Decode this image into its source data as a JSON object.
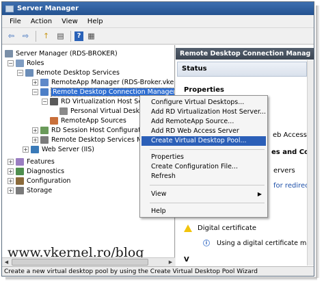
{
  "window": {
    "title": "Server Manager"
  },
  "menu": [
    "File",
    "Action",
    "View",
    "Help"
  ],
  "toolbar": {
    "icons": [
      "back-arrow-icon",
      "forward-arrow-icon",
      "up-folder-icon",
      "show-hide-tree-icon",
      "help-icon",
      "properties-icon"
    ],
    "glyphs": [
      "⇦",
      "⇨",
      "↑",
      "▤",
      "?",
      "▦"
    ]
  },
  "tree": {
    "items": [
      {
        "label": "Server Manager (RDS-BROKER)",
        "expander": ""
      },
      {
        "label": "Roles",
        "expander": "−"
      },
      {
        "label": "Remote Desktop Services",
        "expander": "−"
      },
      {
        "label": "RemoteApp Manager (RDS-Broker.vkern",
        "expander": "+"
      },
      {
        "label": "Remote Desktop Connection Manager",
        "expander": "−"
      },
      {
        "label": "RD Virtualization Host Ser",
        "expander": "−"
      },
      {
        "label": "Personal Virtual Deskt",
        "expander": ""
      },
      {
        "label": "RemoteApp Sources",
        "expander": ""
      },
      {
        "label": "RD Session Host Configuratio",
        "expander": "+"
      },
      {
        "label": "Remote Desktop Services Ma",
        "expander": "+"
      },
      {
        "label": "Web Server (IIS)",
        "expander": "+"
      },
      {
        "label": "Features",
        "expander": "+"
      },
      {
        "label": "Diagnostics",
        "expander": "+"
      },
      {
        "label": "Configuration",
        "expander": "+"
      },
      {
        "label": "Storage",
        "expander": "+"
      }
    ]
  },
  "watermark": "www.vkernel.ro/blog",
  "right_pane": {
    "header": "Remote Desktop Connection Manag",
    "status": "Status",
    "properties": "Properties",
    "fragment_web_access": "eb Access",
    "fragment_conf": "es and Conf",
    "fragment_servers": "ervers",
    "fragment_redirect": "for redirect",
    "digital_certificate": "Digital certificate",
    "using_cert": "Using a digital certificate ma",
    "cut_row": "V"
  },
  "context_menu": {
    "items": [
      "Configure Virtual Desktops...",
      "Add RD Virtualization Host Server...",
      "Add RemoteApp Source...",
      "Add RD Web Access Server",
      "Create Virtual Desktop Pool...",
      "Properties",
      "Create Configuration File...",
      "Refresh",
      "View",
      "Help"
    ],
    "submenu_arrow": "▶"
  },
  "statusbar": "Create a new virtual desktop pool by using the Create Virtual Desktop Pool Wizard",
  "colors": {
    "selection": "#2f6fd3",
    "menu_highlight": "#2b5fb8",
    "link": "#1c4fa8",
    "title_bar": "#245290"
  }
}
